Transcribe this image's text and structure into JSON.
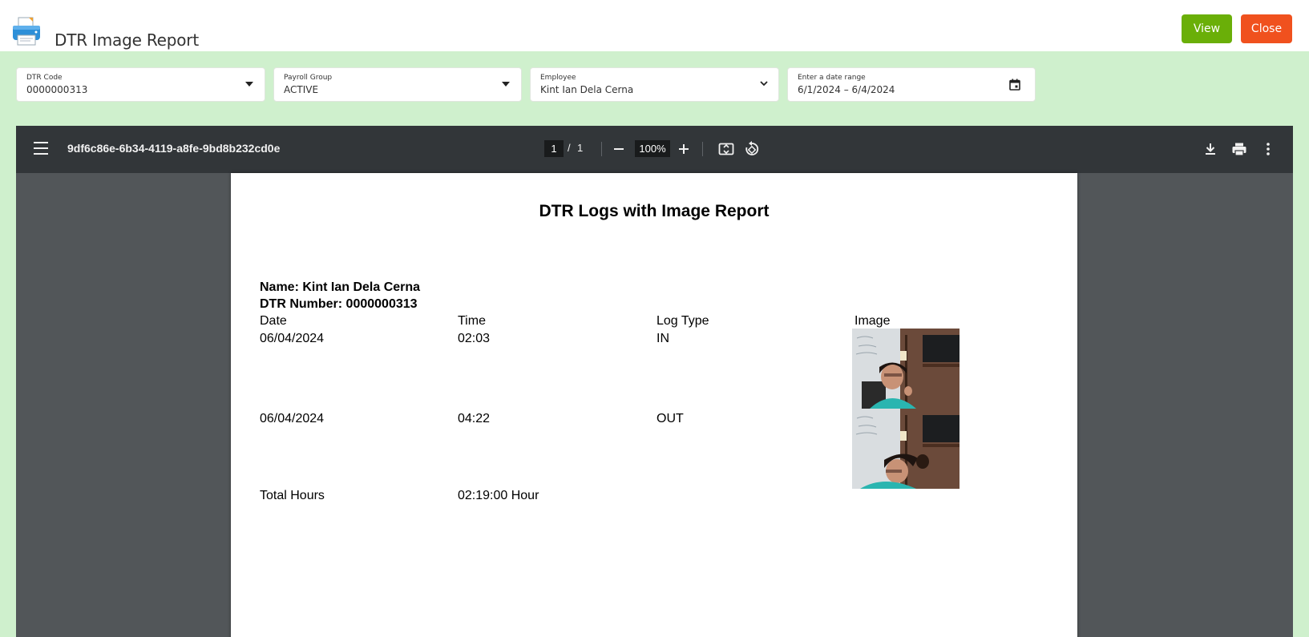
{
  "header": {
    "title": "DTR Image Report",
    "view_label": "View",
    "close_label": "Close",
    "colors": {
      "view": "#6aaf08",
      "close": "#f0511e",
      "band": "#cff0cd"
    }
  },
  "filters": {
    "dtr_code": {
      "label": "DTR Code",
      "value": "0000000313"
    },
    "payroll_group": {
      "label": "Payroll Group",
      "value": "ACTIVE"
    },
    "employee": {
      "label": "Employee",
      "value": "Kint Ian  Dela Cerna"
    },
    "date_range": {
      "label": "Enter a date range",
      "value": "6/1/2024 – 6/4/2024"
    }
  },
  "viewer": {
    "filename": "9df6c86e-6b34-4119-a8fe-9bd8b232cd0e",
    "current_page": "1",
    "page_separator": "/",
    "total_pages": "1",
    "zoom": "100%",
    "icons": [
      "menu-icon",
      "zoom-out-icon",
      "zoom-in-icon",
      "fit-page-icon",
      "rotate-icon",
      "download-icon",
      "print-icon",
      "more-options-icon"
    ]
  },
  "report": {
    "title": "DTR Logs with Image Report",
    "name_line": "Name: Kint Ian  Dela Cerna",
    "dtr_number_line": "DTR Number: 0000000313",
    "columns": [
      "Date",
      "Time",
      "Log Type",
      "Image"
    ],
    "rows": [
      {
        "date": "06/04/2024",
        "time": "02:03",
        "log_type": "IN"
      },
      {
        "date": "06/04/2024",
        "time": "04:22",
        "log_type": "OUT"
      }
    ],
    "total_label": "Total Hours",
    "total_value": "02:19:00 Hour"
  }
}
